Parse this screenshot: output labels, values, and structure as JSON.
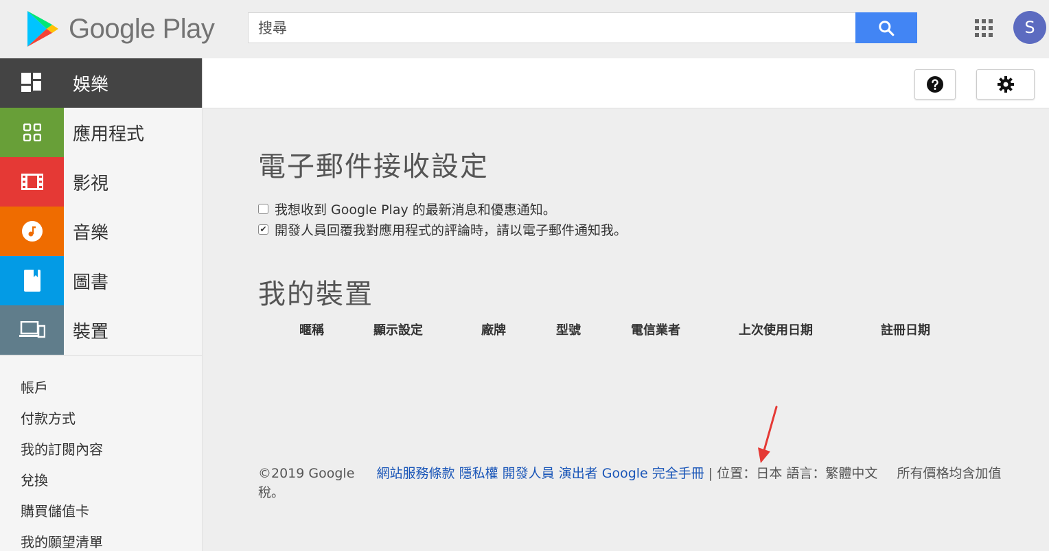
{
  "header": {
    "logo_text": "Google Play",
    "search_placeholder": "搜尋",
    "avatar_letter": "S"
  },
  "sidebar": {
    "nav": [
      {
        "label": "娛樂",
        "icon": "entertainment-icon",
        "color": "#444444"
      },
      {
        "label": "應用程式",
        "icon": "apps-icon",
        "color": "#689f38"
      },
      {
        "label": "影視",
        "icon": "film-icon",
        "color": "#e53935"
      },
      {
        "label": "音樂",
        "icon": "music-note-icon",
        "color": "#ef6c00"
      },
      {
        "label": "圖書",
        "icon": "book-icon",
        "color": "#039be5"
      },
      {
        "label": "裝置",
        "icon": "devices-icon",
        "color": "#607d8b"
      }
    ],
    "links": [
      "帳戶",
      "付款方式",
      "我的訂閱內容",
      "兌換",
      "購買儲值卡",
      "我的願望清單"
    ]
  },
  "main": {
    "email_title": "電子郵件接收設定",
    "checkboxes": [
      {
        "label": "我想收到 Google Play 的最新消息和優惠通知。",
        "checked": false
      },
      {
        "label": "開發人員回覆我對應用程式的評論時，請以電子郵件通知我。",
        "checked": true
      }
    ],
    "devices_title": "我的裝置",
    "device_columns": [
      "暱稱",
      "顯示設定",
      "廠牌",
      "型號",
      "電信業者",
      "上次使用日期",
      "註冊日期"
    ]
  },
  "footer": {
    "copyright": "©2019 Google",
    "links": [
      "網站服務條款",
      "隱私權",
      "開發人員",
      "演出者",
      "Google 完全手冊"
    ],
    "separator": "|",
    "location_label": "位置：",
    "location_value": "日本",
    "language_label": "語言：",
    "language_value": "繁體中文",
    "tax_note": "所有價格均含加值稅。"
  },
  "colors": {
    "accent": "#4285f4",
    "link": "#1a56b8",
    "annotation_arrow": "#e53935"
  }
}
